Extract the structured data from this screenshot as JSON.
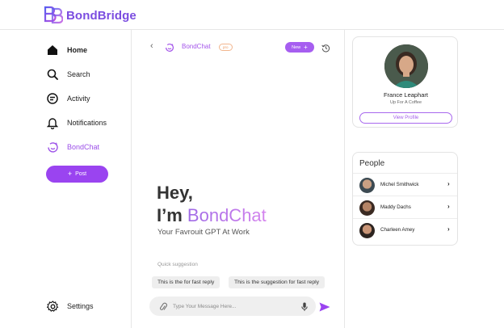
{
  "app": {
    "brand": "BondBridge"
  },
  "sidebar": {
    "items": [
      {
        "label": "Home",
        "icon": "home-icon"
      },
      {
        "label": "Search",
        "icon": "search-icon"
      },
      {
        "label": "Activity",
        "icon": "activity-icon"
      },
      {
        "label": "Notifications",
        "icon": "bell-icon"
      },
      {
        "label": "BondChat",
        "icon": "bondchat-icon"
      }
    ],
    "post_label": "Post",
    "settings_label": "Settings"
  },
  "chat": {
    "title": "BondChat",
    "badge": "pro",
    "new_label": "New",
    "greeting_line1": "Hey,",
    "greeting_prefix": "I’m",
    "greeting_brand": "BondChat",
    "tagline": "Your Favrouit GPT At Work",
    "quick_suggestion_label": "Quick suggestion",
    "suggestions": [
      "This is the for fast reply",
      "This is the suggestion for fast reply"
    ],
    "input_placeholder": "Type Your Message Here..."
  },
  "profile": {
    "name": "France Leaphart",
    "subtitle": "Up For A Coffee",
    "view_label": "View Profile"
  },
  "people": {
    "title": "People",
    "list": [
      {
        "name": "Michel Smithwick"
      },
      {
        "name": "Maddy Dachs"
      },
      {
        "name": "Charleen Amey"
      }
    ]
  },
  "colors": {
    "accent": "#9a44f0",
    "accent_light": "#b572ef",
    "badge": "#ee9a64"
  }
}
